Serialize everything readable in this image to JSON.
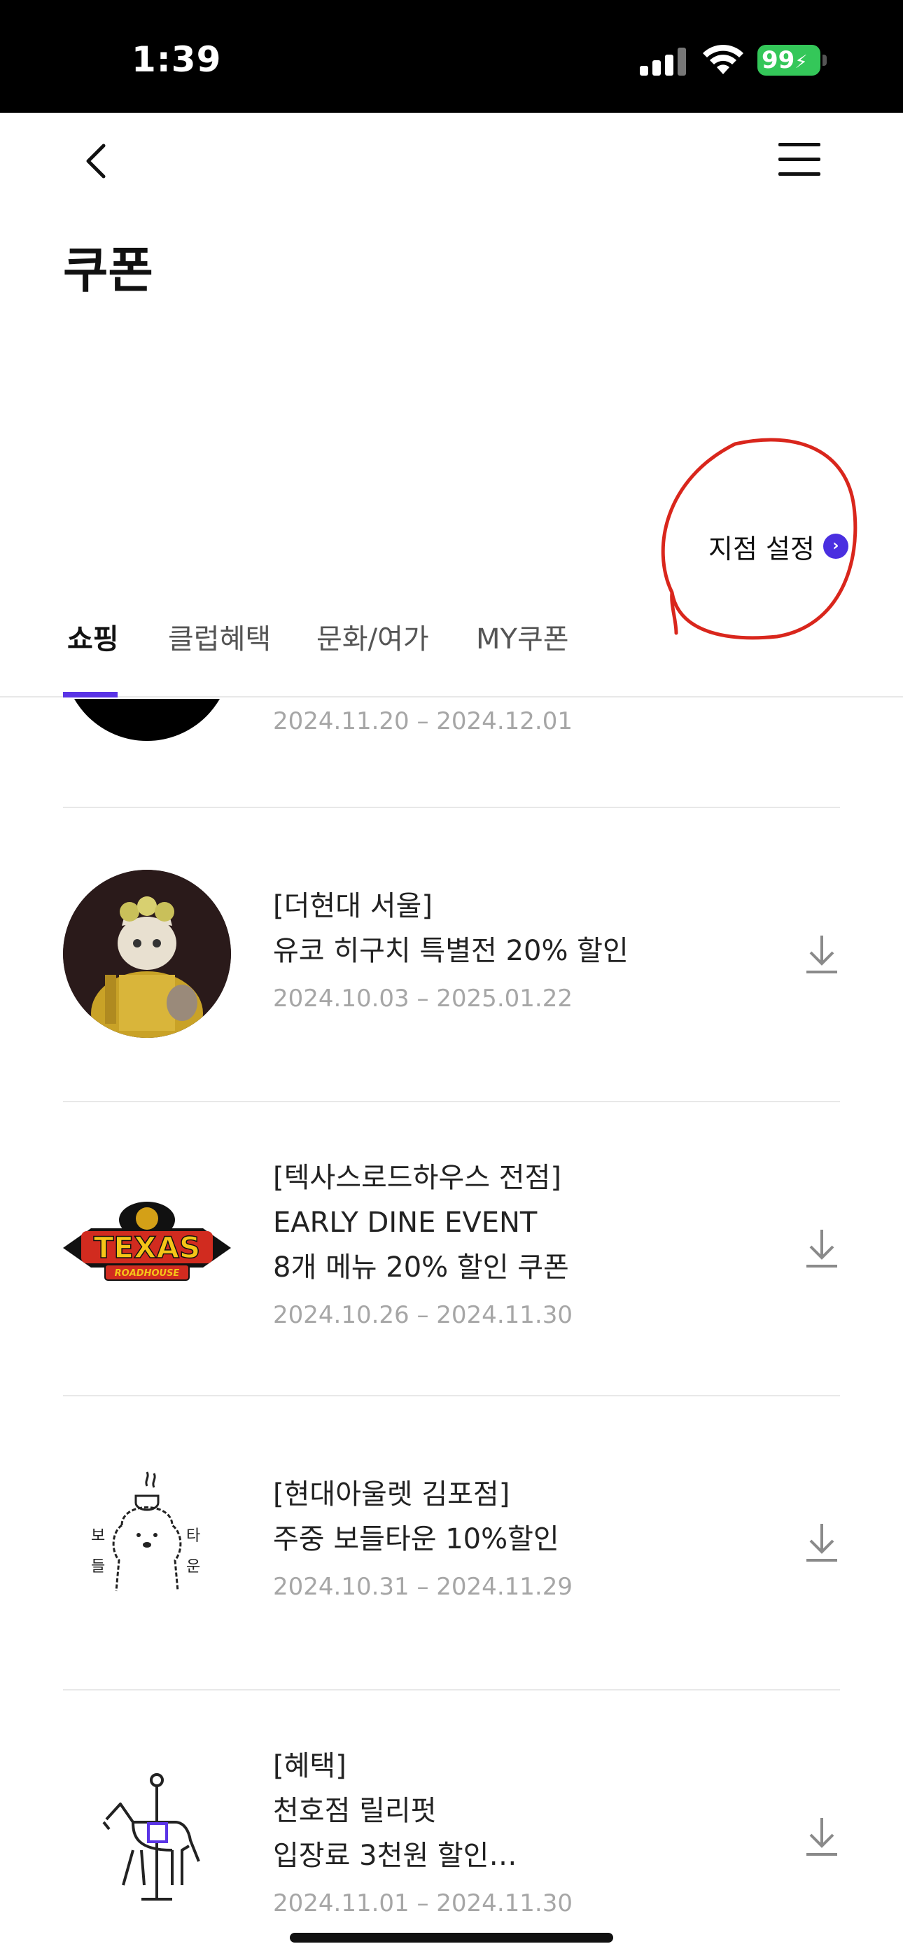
{
  "status_bar": {
    "time": "1:39",
    "battery": "99"
  },
  "header": {
    "title": "쿠폰"
  },
  "branch": {
    "label": "지점 설정"
  },
  "tabs": [
    "쇼핑",
    "클럽혜택",
    "문화/여가",
    "MY쿠폰"
  ],
  "coupons": [
    {
      "lines": [],
      "date": "2024.11.20 – 2024.12.01"
    },
    {
      "lines": [
        "[더현대 서울]",
        "유코 히구치 특별전 20% 할인"
      ],
      "date": "2024.10.03 – 2025.01.22"
    },
    {
      "lines": [
        "[텍사스로드하우스 전점]",
        "EARLY DINE EVENT",
        "8개 메뉴 20% 할인 쿠폰"
      ],
      "date": "2024.10.26 – 2024.11.30"
    },
    {
      "lines": [
        "[현대아울렛 김포점]",
        "주중 보들타운 10%할인"
      ],
      "date": "2024.10.31 – 2024.11.29"
    },
    {
      "lines": [
        "[혜택]",
        "천호점 릴리펏",
        "입장료 3천원 할인…"
      ],
      "date": "2024.11.01 – 2024.11.30"
    }
  ],
  "logos": {
    "texas": {
      "top": "TEXAS",
      "bottom": "ROADHOUSE"
    },
    "bodeul": {
      "chars": [
        "보",
        "들",
        "타",
        "운"
      ]
    }
  },
  "colors": {
    "accent": "#5a34e6",
    "annotation": "#d9261c"
  }
}
